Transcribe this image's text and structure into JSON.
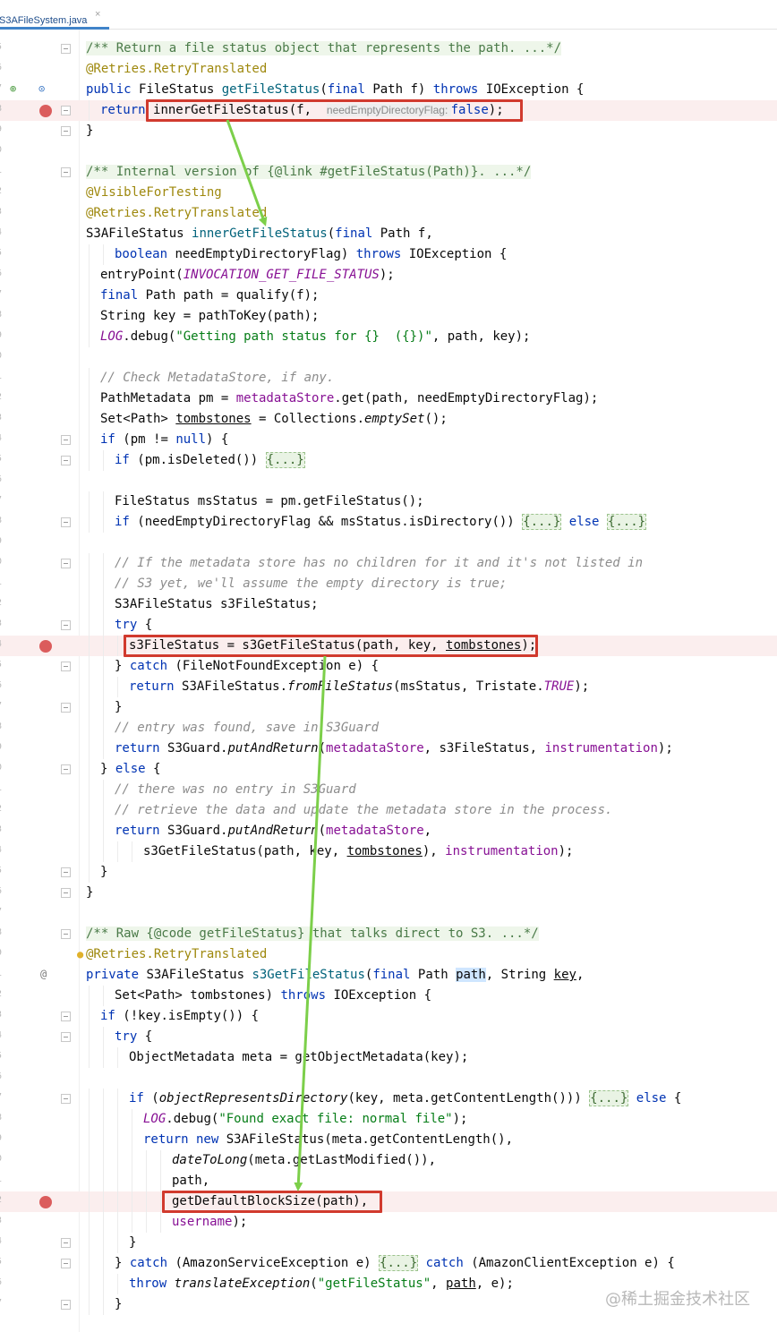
{
  "tab": {
    "label": "S3AFileSystem.java",
    "close": "×"
  },
  "lines": [
    {
      "n": "5",
      "fold": true,
      "indent": 0,
      "tokens": [
        [
          "/** Return a file status object that represents the path. ...*/",
          "doc"
        ]
      ]
    },
    {
      "n": "6",
      "indent": 0,
      "tokens": [
        [
          "@Retries.",
          "ann"
        ],
        [
          "RetryTranslated",
          "ann"
        ]
      ]
    },
    {
      "n": "7",
      "icons": [
        "override-icon",
        "implementing-icon"
      ],
      "indent": 0,
      "tokens": [
        [
          "public ",
          "k"
        ],
        [
          "FileStatus ",
          ""
        ],
        [
          "getFileStatus",
          "fn"
        ],
        [
          "(",
          ""
        ],
        [
          "final ",
          "k"
        ],
        [
          "Path f) ",
          ""
        ],
        [
          "throws ",
          "k"
        ],
        [
          "IOException {",
          ""
        ]
      ]
    },
    {
      "n": "8",
      "bp": true,
      "fold": true,
      "indent": 1,
      "tokens": [
        [
          "return ",
          "k"
        ],
        [
          "innerGetFileStatus(f,  ",
          ""
        ],
        [
          "needEmptyDirectoryFlag: ",
          "hint"
        ],
        [
          "false",
          "k"
        ],
        [
          ");",
          ""
        ]
      ]
    },
    {
      "n": "9",
      "fold": true,
      "indent": 0,
      "tokens": [
        [
          "}",
          ""
        ]
      ]
    },
    {
      "n": "0",
      "indent": 0,
      "tokens": []
    },
    {
      "n": "1",
      "fold": true,
      "indent": 0,
      "tokens": [
        [
          "/** Internal version of {@link #getFileStatus(Path)}. ...*/",
          "doc"
        ]
      ]
    },
    {
      "n": "2",
      "indent": 0,
      "tokens": [
        [
          "@VisibleForTesting",
          "ann"
        ]
      ]
    },
    {
      "n": "3",
      "indent": 0,
      "tokens": [
        [
          "@Retries.",
          "ann"
        ],
        [
          "RetryTranslated",
          "ann"
        ]
      ]
    },
    {
      "n": "4",
      "indent": 0,
      "tokens": [
        [
          "S3AFileStatus ",
          ""
        ],
        [
          "innerGetFileStatus",
          "fn"
        ],
        [
          "(",
          ""
        ],
        [
          "final ",
          "k"
        ],
        [
          "Path f,",
          ""
        ]
      ]
    },
    {
      "n": "5",
      "indent": 2,
      "tokens": [
        [
          "boolean ",
          "k"
        ],
        [
          "needEmptyDirectoryFlag) ",
          ""
        ],
        [
          "throws ",
          "k"
        ],
        [
          "IOException {",
          ""
        ]
      ]
    },
    {
      "n": "6",
      "indent": 1,
      "tokens": [
        [
          "entryPoint(",
          ""
        ],
        [
          "INVOCATION_GET_FILE_STATUS",
          "fld it"
        ],
        [
          ");",
          ""
        ]
      ]
    },
    {
      "n": "7",
      "indent": 1,
      "tokens": [
        [
          "final ",
          "k"
        ],
        [
          "Path path = qualify(f);",
          ""
        ]
      ]
    },
    {
      "n": "8",
      "indent": 1,
      "tokens": [
        [
          "String key = pathToKey(path);",
          ""
        ]
      ]
    },
    {
      "n": "9",
      "indent": 1,
      "tokens": [
        [
          "LOG",
          "fld it"
        ],
        [
          ".debug(",
          ""
        ],
        [
          "\"Getting path status for {}  ({})\"",
          "str"
        ],
        [
          ", path, key);",
          ""
        ]
      ]
    },
    {
      "n": "0",
      "indent": 0,
      "tokens": []
    },
    {
      "n": "1",
      "indent": 1,
      "tokens": [
        [
          "// Check MetadataStore, if any.",
          "cm"
        ]
      ]
    },
    {
      "n": "2",
      "indent": 1,
      "tokens": [
        [
          "PathMetadata pm = ",
          ""
        ],
        [
          "metadataStore",
          "fld"
        ],
        [
          ".get(path, needEmptyDirectoryFlag);",
          ""
        ]
      ]
    },
    {
      "n": "3",
      "indent": 1,
      "tokens": [
        [
          "Set<Path> ",
          ""
        ],
        [
          "tombstones",
          "ul"
        ],
        [
          " = Collections.",
          ""
        ],
        [
          "emptySet",
          "it"
        ],
        [
          "();",
          ""
        ]
      ]
    },
    {
      "n": "4",
      "fold": true,
      "indent": 1,
      "tokens": [
        [
          "if ",
          "k"
        ],
        [
          "(pm != ",
          ""
        ],
        [
          "null",
          "k"
        ],
        [
          ") {",
          ""
        ]
      ]
    },
    {
      "n": "5",
      "fold": true,
      "indent": 2,
      "tokens": [
        [
          "if ",
          "k"
        ],
        [
          "(pm.isDeleted()) ",
          ""
        ],
        [
          "{...}",
          "folded"
        ]
      ]
    },
    {
      "n": "6",
      "indent": 0,
      "tokens": []
    },
    {
      "n": "7",
      "indent": 2,
      "tokens": [
        [
          "FileStatus msStatus = pm.getFileStatus();",
          ""
        ]
      ]
    },
    {
      "n": "8",
      "fold": true,
      "indent": 2,
      "tokens": [
        [
          "if ",
          "k"
        ],
        [
          "(needEmptyDirectoryFlag && msStatus.isDirectory()) ",
          ""
        ],
        [
          "{...}",
          "folded"
        ],
        [
          " ",
          ""
        ],
        [
          "else ",
          "k"
        ],
        [
          "{...}",
          "folded"
        ]
      ]
    },
    {
      "n": "9",
      "indent": 0,
      "tokens": []
    },
    {
      "n": "0",
      "fold": true,
      "indent": 2,
      "tokens": [
        [
          "// If the metadata store has no children for it and it's not listed in",
          "cm"
        ]
      ]
    },
    {
      "n": "1",
      "indent": 2,
      "tokens": [
        [
          "// S3 yet, we'll assume the empty directory is true;",
          "cm"
        ]
      ]
    },
    {
      "n": "2",
      "indent": 2,
      "tokens": [
        [
          "S3AFileStatus s3FileStatus;",
          ""
        ]
      ]
    },
    {
      "n": "3",
      "fold": true,
      "indent": 2,
      "tokens": [
        [
          "try ",
          "k"
        ],
        [
          "{",
          ""
        ]
      ]
    },
    {
      "n": "4",
      "bp": true,
      "indent": 3,
      "tokens": [
        [
          "s3FileStatus = s3GetFileStatus(path, key, ",
          ""
        ],
        [
          "tombstones",
          "ul"
        ],
        [
          ");",
          ""
        ]
      ]
    },
    {
      "n": "5",
      "fold": true,
      "indent": 2,
      "tokens": [
        [
          "} ",
          ""
        ],
        [
          "catch ",
          "k"
        ],
        [
          "(FileNotFoundException e) {",
          ""
        ]
      ]
    },
    {
      "n": "6",
      "indent": 3,
      "tokens": [
        [
          "return ",
          "k"
        ],
        [
          "S3AFileStatus.",
          ""
        ],
        [
          "fromFileStatus",
          "it"
        ],
        [
          "(msStatus, Tristate.",
          ""
        ],
        [
          "TRUE",
          "fld it"
        ],
        [
          ");",
          ""
        ]
      ]
    },
    {
      "n": "7",
      "fold": true,
      "indent": 2,
      "tokens": [
        [
          "}",
          ""
        ]
      ]
    },
    {
      "n": "8",
      "indent": 2,
      "tokens": [
        [
          "// entry was found, save in S3Guard",
          "cm"
        ]
      ]
    },
    {
      "n": "9",
      "indent": 2,
      "tokens": [
        [
          "return ",
          "k"
        ],
        [
          "S3Guard.",
          ""
        ],
        [
          "putAndReturn",
          "it"
        ],
        [
          "(",
          ""
        ],
        [
          "metadataStore",
          "fld"
        ],
        [
          ", s3FileStatus, ",
          ""
        ],
        [
          "instrumentation",
          "fld"
        ],
        [
          ");",
          ""
        ]
      ]
    },
    {
      "n": "0",
      "fold": true,
      "indent": 1,
      "tokens": [
        [
          "} ",
          ""
        ],
        [
          "else ",
          "k"
        ],
        [
          "{",
          ""
        ]
      ]
    },
    {
      "n": "1",
      "indent": 2,
      "tokens": [
        [
          "// there was no entry in S3Guard",
          "cm"
        ]
      ]
    },
    {
      "n": "2",
      "indent": 2,
      "tokens": [
        [
          "// retrieve the data and update the metadata store in the process.",
          "cm"
        ]
      ]
    },
    {
      "n": "3",
      "indent": 2,
      "tokens": [
        [
          "return ",
          "k"
        ],
        [
          "S3Guard.",
          ""
        ],
        [
          "putAndReturn",
          "it"
        ],
        [
          "(",
          ""
        ],
        [
          "metadataStore",
          "fld"
        ],
        [
          ",",
          ""
        ]
      ]
    },
    {
      "n": "4",
      "indent": 4,
      "tokens": [
        [
          "s3GetFileStatus(path, key, ",
          ""
        ],
        [
          "tombstones",
          "ul"
        ],
        [
          "), ",
          ""
        ],
        [
          "instrumentation",
          "fld"
        ],
        [
          ");",
          ""
        ]
      ]
    },
    {
      "n": "5",
      "fold": true,
      "indent": 1,
      "tokens": [
        [
          "}",
          ""
        ]
      ]
    },
    {
      "n": "6",
      "fold": true,
      "indent": 0,
      "tokens": [
        [
          "}",
          ""
        ]
      ]
    },
    {
      "n": "7",
      "indent": 0,
      "tokens": []
    },
    {
      "n": "8",
      "fold": true,
      "indent": 0,
      "tokens": [
        [
          "/** Raw {@code getFileStatus} that talks direct to S3. ...*/",
          "doc"
        ]
      ]
    },
    {
      "n": "9",
      "icons": [
        "bulb-icon"
      ],
      "indent": 0,
      "tokens": [
        [
          "@Retries.",
          "ann"
        ],
        [
          "RetryTranslated",
          "ann"
        ]
      ]
    },
    {
      "n": "1",
      "icons": [
        "at-icon"
      ],
      "indent": 0,
      "tokens": [
        [
          "private ",
          "k"
        ],
        [
          "S3AFileStatus ",
          ""
        ],
        [
          "s3GetFileStatus",
          "fn"
        ],
        [
          "(",
          ""
        ],
        [
          "final ",
          "k"
        ],
        [
          "Path ",
          ""
        ],
        [
          "path",
          "sel"
        ],
        [
          ", String ",
          ""
        ],
        [
          "key",
          "ul"
        ],
        [
          ",",
          ""
        ]
      ]
    },
    {
      "n": "2",
      "indent": 2,
      "tokens": [
        [
          "Set<Path> tombstones) ",
          ""
        ],
        [
          "throws ",
          "k"
        ],
        [
          "IOException {",
          ""
        ]
      ]
    },
    {
      "n": "3",
      "fold": true,
      "indent": 1,
      "tokens": [
        [
          "if ",
          "k"
        ],
        [
          "(!key.isEmpty()) {",
          ""
        ]
      ]
    },
    {
      "n": "4",
      "fold": true,
      "indent": 2,
      "tokens": [
        [
          "try ",
          "k"
        ],
        [
          "{",
          ""
        ]
      ]
    },
    {
      "n": "5",
      "indent": 3,
      "tokens": [
        [
          "ObjectMetadata meta = getObjectMetadata(key);",
          ""
        ]
      ]
    },
    {
      "n": "6",
      "indent": 0,
      "tokens": []
    },
    {
      "n": "7",
      "fold": true,
      "indent": 3,
      "tokens": [
        [
          "if ",
          "k"
        ],
        [
          "(",
          ""
        ],
        [
          "objectRepresentsDirectory",
          "it"
        ],
        [
          "(key, meta.getContentLength())) ",
          ""
        ],
        [
          "{...}",
          "folded"
        ],
        [
          " ",
          ""
        ],
        [
          "else ",
          "k"
        ],
        [
          "{",
          ""
        ]
      ]
    },
    {
      "n": "8",
      "indent": 4,
      "tokens": [
        [
          "LOG",
          "fld it"
        ],
        [
          ".debug(",
          ""
        ],
        [
          "\"Found exact file: normal file\"",
          "str"
        ],
        [
          ");",
          ""
        ]
      ]
    },
    {
      "n": "9",
      "indent": 4,
      "tokens": [
        [
          "return new ",
          "k"
        ],
        [
          "S3AFileStatus(meta.getContentLength(),",
          ""
        ]
      ]
    },
    {
      "n": "0",
      "indent": 6,
      "tokens": [
        [
          "dateToLong",
          "it"
        ],
        [
          "(meta.getLastModified()),",
          ""
        ]
      ]
    },
    {
      "n": "1",
      "indent": 6,
      "tokens": [
        [
          "path,",
          ""
        ]
      ]
    },
    {
      "n": "2",
      "bp": true,
      "indent": 6,
      "tokens": [
        [
          "getDefaultBlockSize(path),",
          ""
        ]
      ]
    },
    {
      "n": "3",
      "indent": 6,
      "tokens": [
        [
          "username",
          "fld"
        ],
        [
          ");",
          ""
        ]
      ]
    },
    {
      "n": "4",
      "fold": true,
      "indent": 3,
      "tokens": [
        [
          "}",
          ""
        ]
      ]
    },
    {
      "n": "5",
      "fold": true,
      "indent": 2,
      "tokens": [
        [
          "} ",
          ""
        ],
        [
          "catch ",
          "k"
        ],
        [
          "(AmazonServiceException e) ",
          ""
        ],
        [
          "{...}",
          "folded"
        ],
        [
          " ",
          ""
        ],
        [
          "catch ",
          "k"
        ],
        [
          "(AmazonClientException e) {",
          ""
        ]
      ]
    },
    {
      "n": "6",
      "indent": 3,
      "tokens": [
        [
          "throw ",
          "k"
        ],
        [
          "translateException",
          "it"
        ],
        [
          "(",
          ""
        ],
        [
          "\"getFileStatus\"",
          "str"
        ],
        [
          ", ",
          ""
        ],
        [
          "path",
          "ul"
        ],
        [
          ", e);",
          ""
        ]
      ]
    },
    {
      "n": "7",
      "fold": true,
      "indent": 2,
      "tokens": [
        [
          "}",
          ""
        ]
      ]
    }
  ],
  "annotations": {
    "highlight_color": "#d13a2e",
    "arrow_color": "#7ccf4a"
  },
  "watermark": "@稀土掘金技术社区"
}
